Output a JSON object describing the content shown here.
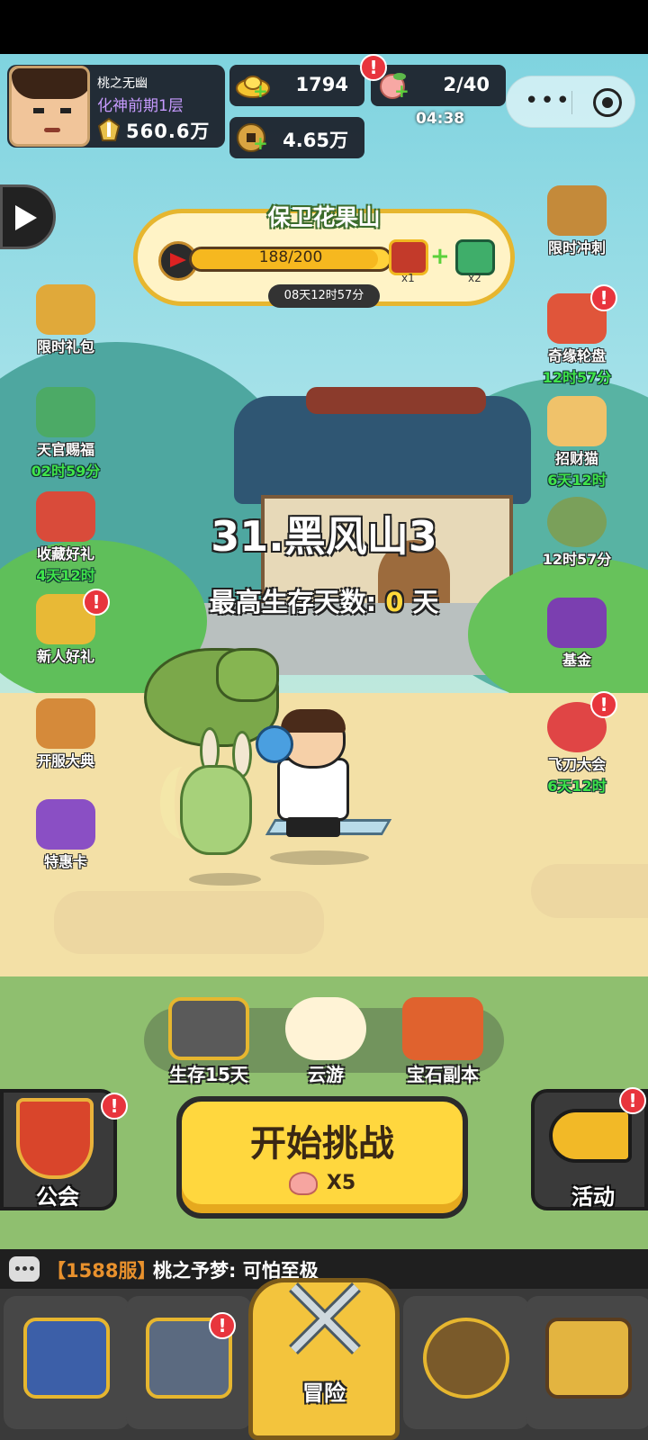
{
  "player": {
    "name": "桃之无幽",
    "realm": "化神前期1层",
    "power": "560.6万"
  },
  "resources": {
    "gold": "1794",
    "copper": "4.65万",
    "stamina": "2/40",
    "stamina_timer": "04:38"
  },
  "event": {
    "title": "保卫花果山",
    "progress": "188/200",
    "progress_fraction": 0.94,
    "reward1_count": "x1",
    "reward2_count": "x2",
    "time_left": "08天12时57分"
  },
  "left_icons": [
    {
      "label": "限时礼包",
      "sub": ""
    },
    {
      "label": "天官赐福",
      "sub": "02时59分"
    },
    {
      "label": "收藏好礼",
      "sub": "4天12时"
    },
    {
      "label": "新人好礼",
      "sub": ""
    },
    {
      "label": "开服大典",
      "sub": ""
    },
    {
      "label": "特惠卡",
      "sub": ""
    }
  ],
  "right_icons": [
    {
      "label": "限时冲刺",
      "sub": ""
    },
    {
      "label": "奇缘轮盘",
      "sub": "12时57分"
    },
    {
      "label": "招财猫",
      "sub": "6天12时"
    },
    {
      "label": "12时57分",
      "sub": ""
    },
    {
      "label": "基金",
      "sub": ""
    },
    {
      "label": "飞刀大会",
      "sub": "6天12时"
    }
  ],
  "stage": {
    "name": "31.黑风山3",
    "survive_label": "最高生存天数:",
    "survive_days": "0",
    "survive_unit": "天"
  },
  "modes": [
    {
      "label": "生存15天"
    },
    {
      "label": "云游"
    },
    {
      "label": "宝石副本"
    }
  ],
  "buttons": {
    "guild": "公会",
    "activity": "活动",
    "start": "开始挑战",
    "start_cost": "X5"
  },
  "badge": "!",
  "chat": {
    "server": "【1588服】",
    "message": "桃之予梦: 可怕至极"
  },
  "nav": {
    "active_label": "冒险"
  },
  "colors": {
    "accent_yellow": "#ffd73e",
    "alert_red": "#e8353d",
    "timer_green": "#3fe44a",
    "realm_purple": "#c79bff"
  }
}
